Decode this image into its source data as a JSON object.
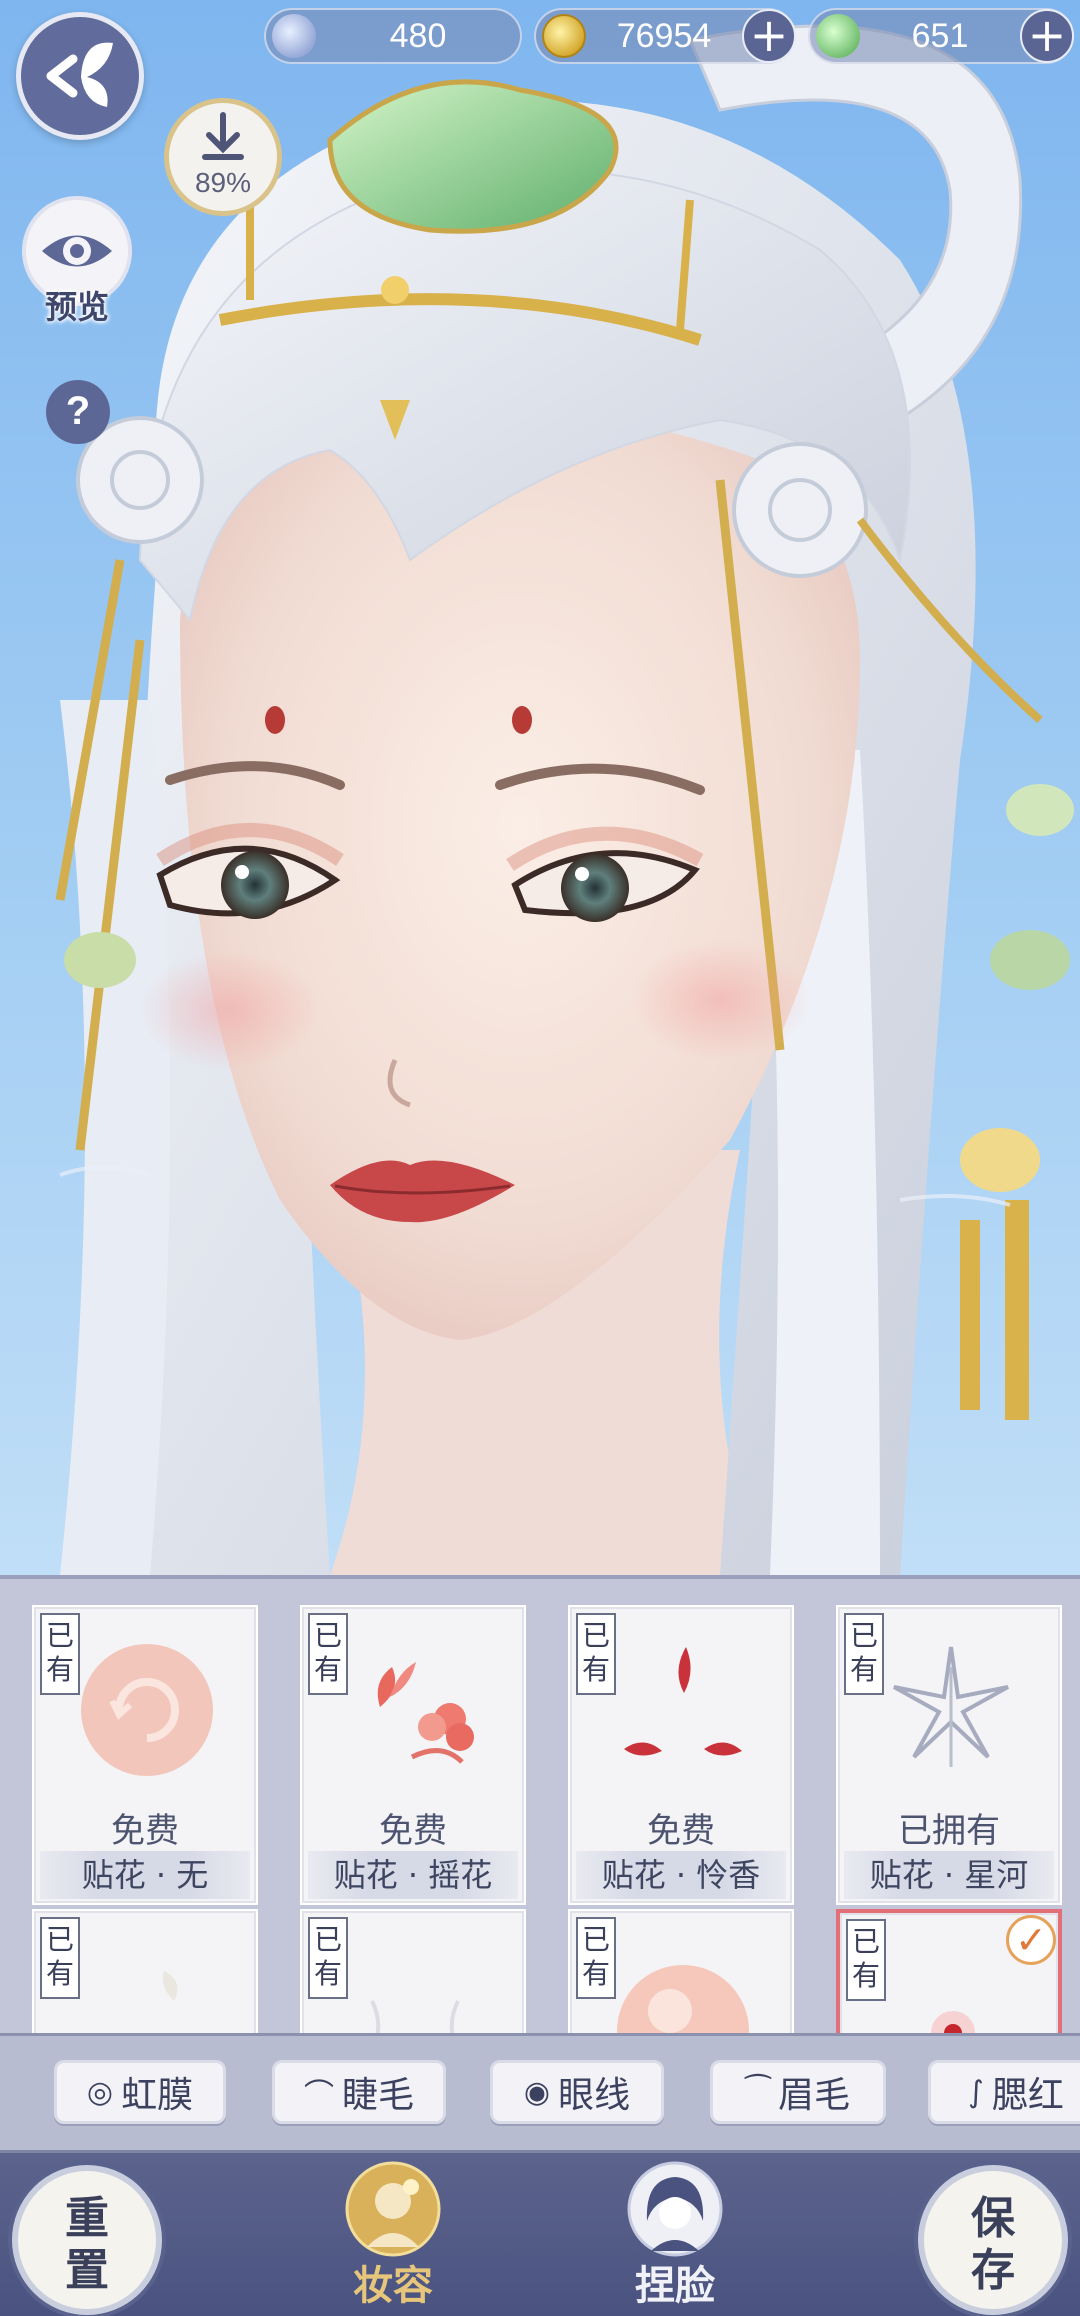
{
  "currency": {
    "silver": "480",
    "coins": "76954",
    "jade": "651",
    "plus": "+"
  },
  "left_controls": {
    "download_percent": "89%",
    "preview_label": "预览",
    "help": "?"
  },
  "makeup_items": [
    {
      "tag": "已有",
      "price": "免费",
      "name": "贴花 · 无",
      "selected": false
    },
    {
      "tag": "已有",
      "price": "免费",
      "name": "贴花 · 摇花",
      "selected": false
    },
    {
      "tag": "已有",
      "price": "免费",
      "name": "贴花 · 怜香",
      "selected": false
    },
    {
      "tag": "已有",
      "price": "已拥有",
      "name": "贴花 · 星河",
      "selected": false
    },
    {
      "tag": "已有",
      "price": "",
      "name": "",
      "selected": false
    },
    {
      "tag": "已有",
      "price": "",
      "name": "",
      "selected": false
    },
    {
      "tag": "已有",
      "price": "",
      "name": "",
      "selected": false
    },
    {
      "tag": "已有",
      "price": "",
      "name": "",
      "selected": true
    }
  ],
  "check_mark": "✓",
  "category_tabs": [
    {
      "label": "虹膜",
      "icon": "◎"
    },
    {
      "label": "睫毛",
      "icon": "⌒"
    },
    {
      "label": "眼线",
      "icon": "◉"
    },
    {
      "label": "眉毛",
      "icon": "⁀"
    },
    {
      "label": "腮红",
      "icon": "∫"
    }
  ],
  "bottom_nav": {
    "reset": [
      "重",
      "置"
    ],
    "makeup_tab": "妆容",
    "face_tab": "捏脸",
    "save": [
      "保",
      "存"
    ]
  }
}
